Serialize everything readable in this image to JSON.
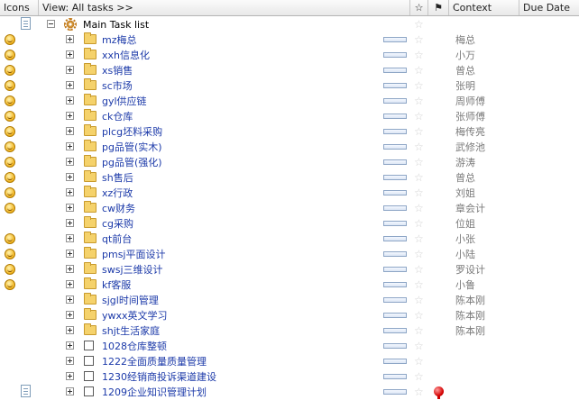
{
  "header": {
    "icons": "Icons",
    "view": "View: All tasks >>",
    "star": "☆",
    "context": "Context",
    "due_date": "Due Date"
  },
  "root": {
    "name": "Main Task list"
  },
  "rows": [
    {
      "name": "mz梅总",
      "context": "梅总",
      "smile": true,
      "type": "folder"
    },
    {
      "name": "xxh信息化",
      "context": "小万",
      "smile": true,
      "type": "folder"
    },
    {
      "name": "xs销售",
      "context": "曾总",
      "smile": true,
      "type": "folder"
    },
    {
      "name": "sc市场",
      "context": "张明",
      "smile": true,
      "type": "folder"
    },
    {
      "name": "gyl供应链",
      "context": "周师傅",
      "smile": true,
      "type": "folder"
    },
    {
      "name": "ck仓库",
      "context": "张师傅",
      "smile": true,
      "type": "folder"
    },
    {
      "name": "plcg坯料采购",
      "context": "梅传亮",
      "smile": true,
      "type": "folder"
    },
    {
      "name": "pg品管(实木)",
      "context": "武修池",
      "smile": true,
      "type": "folder"
    },
    {
      "name": "pg品管(强化)",
      "context": "游涛",
      "smile": true,
      "type": "folder"
    },
    {
      "name": "sh售后",
      "context": "曾总",
      "smile": true,
      "type": "folder"
    },
    {
      "name": "xz行政",
      "context": "刘姐",
      "smile": true,
      "type": "folder"
    },
    {
      "name": "cw财务",
      "context": "章会计",
      "smile": true,
      "type": "folder"
    },
    {
      "name": "cg采购",
      "context": "位姐",
      "smile": false,
      "type": "folder"
    },
    {
      "name": "qt前台",
      "context": "小张",
      "smile": true,
      "type": "folder"
    },
    {
      "name": "pmsj平面设计",
      "context": "小陆",
      "smile": true,
      "type": "folder"
    },
    {
      "name": "swsj三维设计",
      "context": "罗设计",
      "smile": true,
      "type": "folder"
    },
    {
      "name": "kf客服",
      "context": "小鲁",
      "smile": true,
      "type": "folder"
    },
    {
      "name": "sjgl时间管理",
      "context": "陈本刚",
      "smile": false,
      "type": "folder"
    },
    {
      "name": "ywxx英文学习",
      "context": "陈本刚",
      "smile": false,
      "type": "folder"
    },
    {
      "name": "shjt生活家庭",
      "context": "陈本刚",
      "smile": false,
      "type": "folder"
    },
    {
      "name": "1028仓库整顿",
      "context": "",
      "smile": false,
      "type": "task"
    },
    {
      "name": "1222全面质量质量管理",
      "context": "",
      "smile": false,
      "type": "task"
    },
    {
      "name": "1230经销商投诉渠道建设",
      "context": "",
      "smile": false,
      "type": "task"
    },
    {
      "name": "1209企业知识管理计划",
      "context": "",
      "smile": false,
      "type": "task",
      "doc": true,
      "pin": true
    }
  ]
}
